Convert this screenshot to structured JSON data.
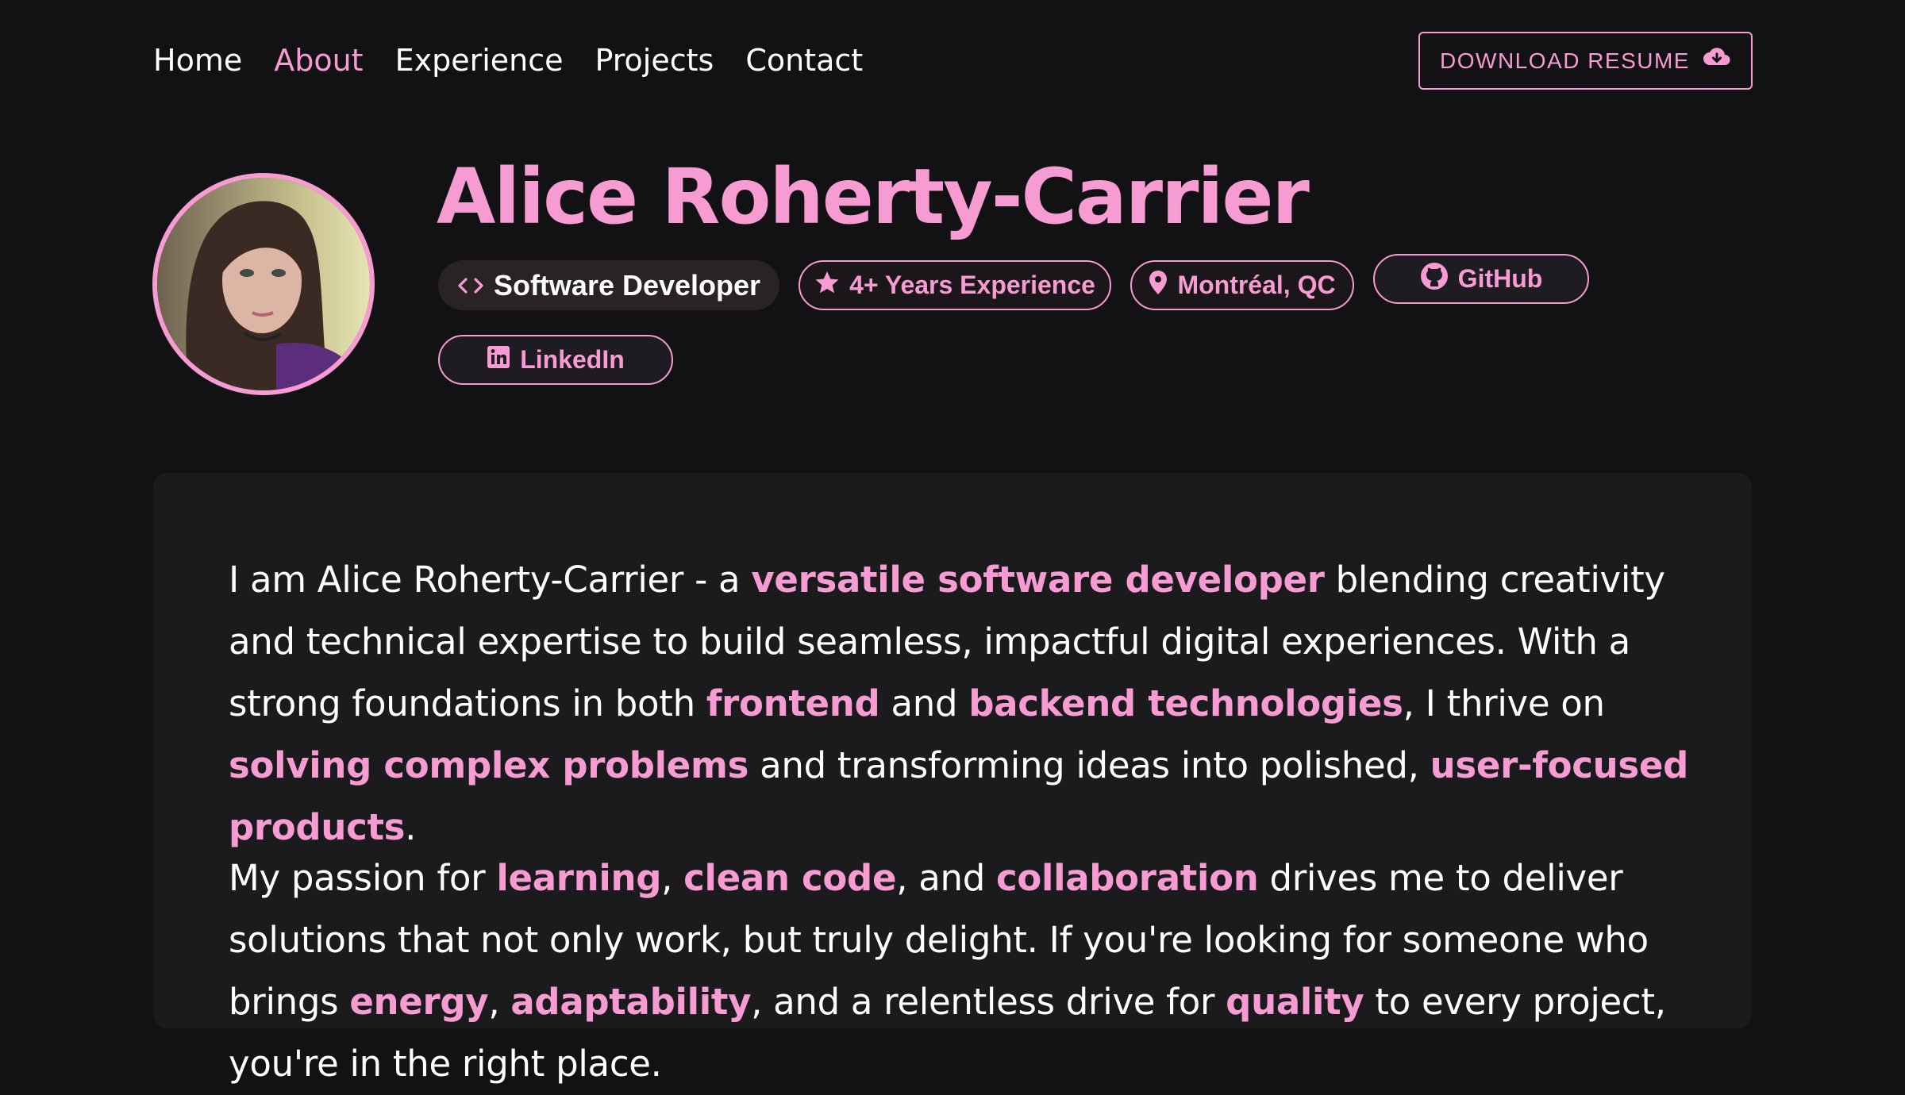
{
  "nav": {
    "items": [
      {
        "label": "Home"
      },
      {
        "label": "About",
        "active": true
      },
      {
        "label": "Experience"
      },
      {
        "label": "Projects"
      },
      {
        "label": "Contact"
      }
    ],
    "resume_label": "DOWNLOAD RESUME",
    "resume_icon": "cloud-download-icon"
  },
  "profile": {
    "name": "Alice Roherty-Carrier",
    "badges": {
      "role": "Software Developer",
      "experience": "4+ Years Experience",
      "location": "Montréal, QC",
      "github": "GitHub",
      "linkedin": "LinkedIn"
    }
  },
  "about": {
    "p1": [
      {
        "t": "I am Alice Roherty-Carrier - a "
      },
      {
        "t": "versatile software developer",
        "hl": true
      },
      {
        "t": " blending creativity and technical expertise to build seamless, impactful digital experiences. With a strong foundations in both "
      },
      {
        "t": "frontend",
        "hl": true
      },
      {
        "t": " and "
      },
      {
        "t": "backend technologies",
        "hl": true
      },
      {
        "t": ", I thrive on "
      },
      {
        "t": "solving complex problems",
        "hl": true
      },
      {
        "t": " and transforming ideas into polished, "
      },
      {
        "t": "user-focused products",
        "hl": true
      },
      {
        "t": "."
      }
    ],
    "p2": [
      {
        "t": "My passion for "
      },
      {
        "t": "learning",
        "hl": true
      },
      {
        "t": ", "
      },
      {
        "t": "clean code",
        "hl": true
      },
      {
        "t": ", and "
      },
      {
        "t": "collaboration",
        "hl": true
      },
      {
        "t": " drives me to deliver solutions that not only work, but truly delight. If you're looking for someone who brings "
      },
      {
        "t": "energy",
        "hl": true
      },
      {
        "t": ", "
      },
      {
        "t": "adaptability",
        "hl": true
      },
      {
        "t": ", and a relentless drive for "
      },
      {
        "t": "quality",
        "hl": true
      },
      {
        "t": " to every project, you're in the right place."
      }
    ]
  },
  "colors": {
    "accent": "#f79bd3",
    "background": "#121113",
    "card": "#1b1a1d"
  }
}
